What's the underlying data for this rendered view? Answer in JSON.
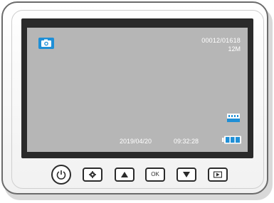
{
  "screen": {
    "mode_icon": "camera-icon",
    "photo_counter": "00012/01618",
    "resolution": "12M",
    "date": "2019/04/20",
    "time": "09:32:28",
    "storage_icon": "sd-card-icon",
    "battery_icon": "battery-icon",
    "mode_color": "#1f8fd6",
    "battery_color": "#1f8fd6"
  },
  "buttons": {
    "ok_label": "OK",
    "power_icon": "power-icon",
    "settings_icon": "gear-icon",
    "up_icon": "triangle-up-icon",
    "down_icon": "triangle-down-icon",
    "playback_icon": "playback-icon"
  }
}
